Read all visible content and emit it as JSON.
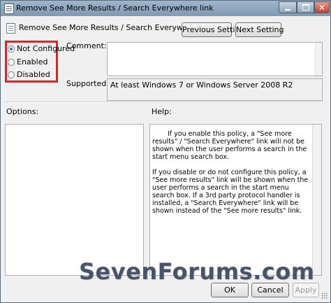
{
  "window": {
    "title": "Remove See More Results / Search Everywhere link"
  },
  "header": {
    "policy_name": "Remove See More Results / Search Everywhere link",
    "prev_label": "Previous Setting",
    "next_label": "Next Setting"
  },
  "state": {
    "options": [
      {
        "label": "Not Configured",
        "selected": true
      },
      {
        "label": "Enabled",
        "selected": false
      },
      {
        "label": "Disabled",
        "selected": false
      }
    ],
    "highlight_color": "#d5262b"
  },
  "comment": {
    "label": "Comment:",
    "value": ""
  },
  "supported": {
    "label": "Supported on:",
    "value": "At least Windows 7 or Windows Server 2008 R2"
  },
  "panels": {
    "options_label": "Options:",
    "help_label": "Help:",
    "help_paragraphs": [
      "If you enable this policy, a \"See more results\" / \"Search Everywhere\" link will not be shown when the user performs a search in the start menu search box.",
      "If you disable or do not configure this policy, a \"See more results\" link will be shown when the user performs a search in the start menu search box.  If a 3rd party protocol handler is installed, a \"Search Everywhere\" link will be shown instead of the \"See more results\" link."
    ]
  },
  "footer": {
    "ok_label": "OK",
    "cancel_label": "Cancel",
    "apply_label": "Apply"
  },
  "watermark": "SevenForums.com"
}
